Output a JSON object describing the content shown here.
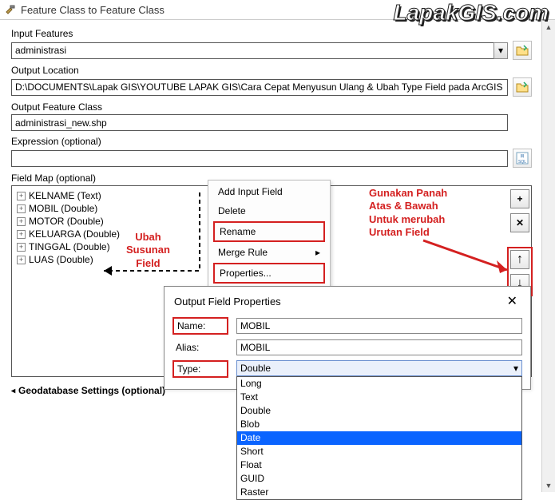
{
  "window": {
    "title": "Feature Class to Feature Class"
  },
  "watermark": "LapakGIS.com",
  "labels": {
    "input_features": "Input Features",
    "output_location": "Output Location",
    "output_feature_class": "Output Feature Class",
    "expression": "Expression (optional)",
    "field_map": "Field Map (optional)",
    "geodb": "Geodatabase Settings (optional)"
  },
  "values": {
    "input_features": "administrasi",
    "output_location": "D:\\DOCUMENTS\\Lapak GIS\\YOUTUBE LAPAK GIS\\Cara Cepat Menyusun Ulang & Ubah Type Field pada ArcGIS",
    "output_feature_class": "administrasi_new.shp",
    "expression": ""
  },
  "fieldmap_items": [
    "KELNAME (Text)",
    "MOBIL (Double)",
    "MOTOR (Double)",
    "KELUARGA (Double)",
    "TINGGAL (Double)",
    "LUAS (Double)"
  ],
  "context_menu": {
    "add_input": "Add Input Field",
    "delete": "Delete",
    "rename": "Rename",
    "merge": "Merge Rule",
    "properties": "Properties..."
  },
  "annotations": {
    "left": "Ubah\nSusunan\nField",
    "right": "Gunakan Panah\nAtas & Bawah\nUntuk merubah\nUrutan Field"
  },
  "dialog": {
    "title": "Output Field Properties",
    "name_label": "Name:",
    "alias_label": "Alias:",
    "type_label": "Type:",
    "name_value": "MOBIL",
    "alias_value": "MOBIL",
    "type_value": "Double",
    "type_options": [
      "Long",
      "Text",
      "Double",
      "Blob",
      "Date",
      "Short",
      "Float",
      "GUID",
      "Raster"
    ],
    "type_selected_index": 4
  },
  "icons": {
    "plus": "+",
    "x": "✕",
    "up": "↑",
    "down": "↓",
    "dd": "▾",
    "chev_right": "▸"
  }
}
